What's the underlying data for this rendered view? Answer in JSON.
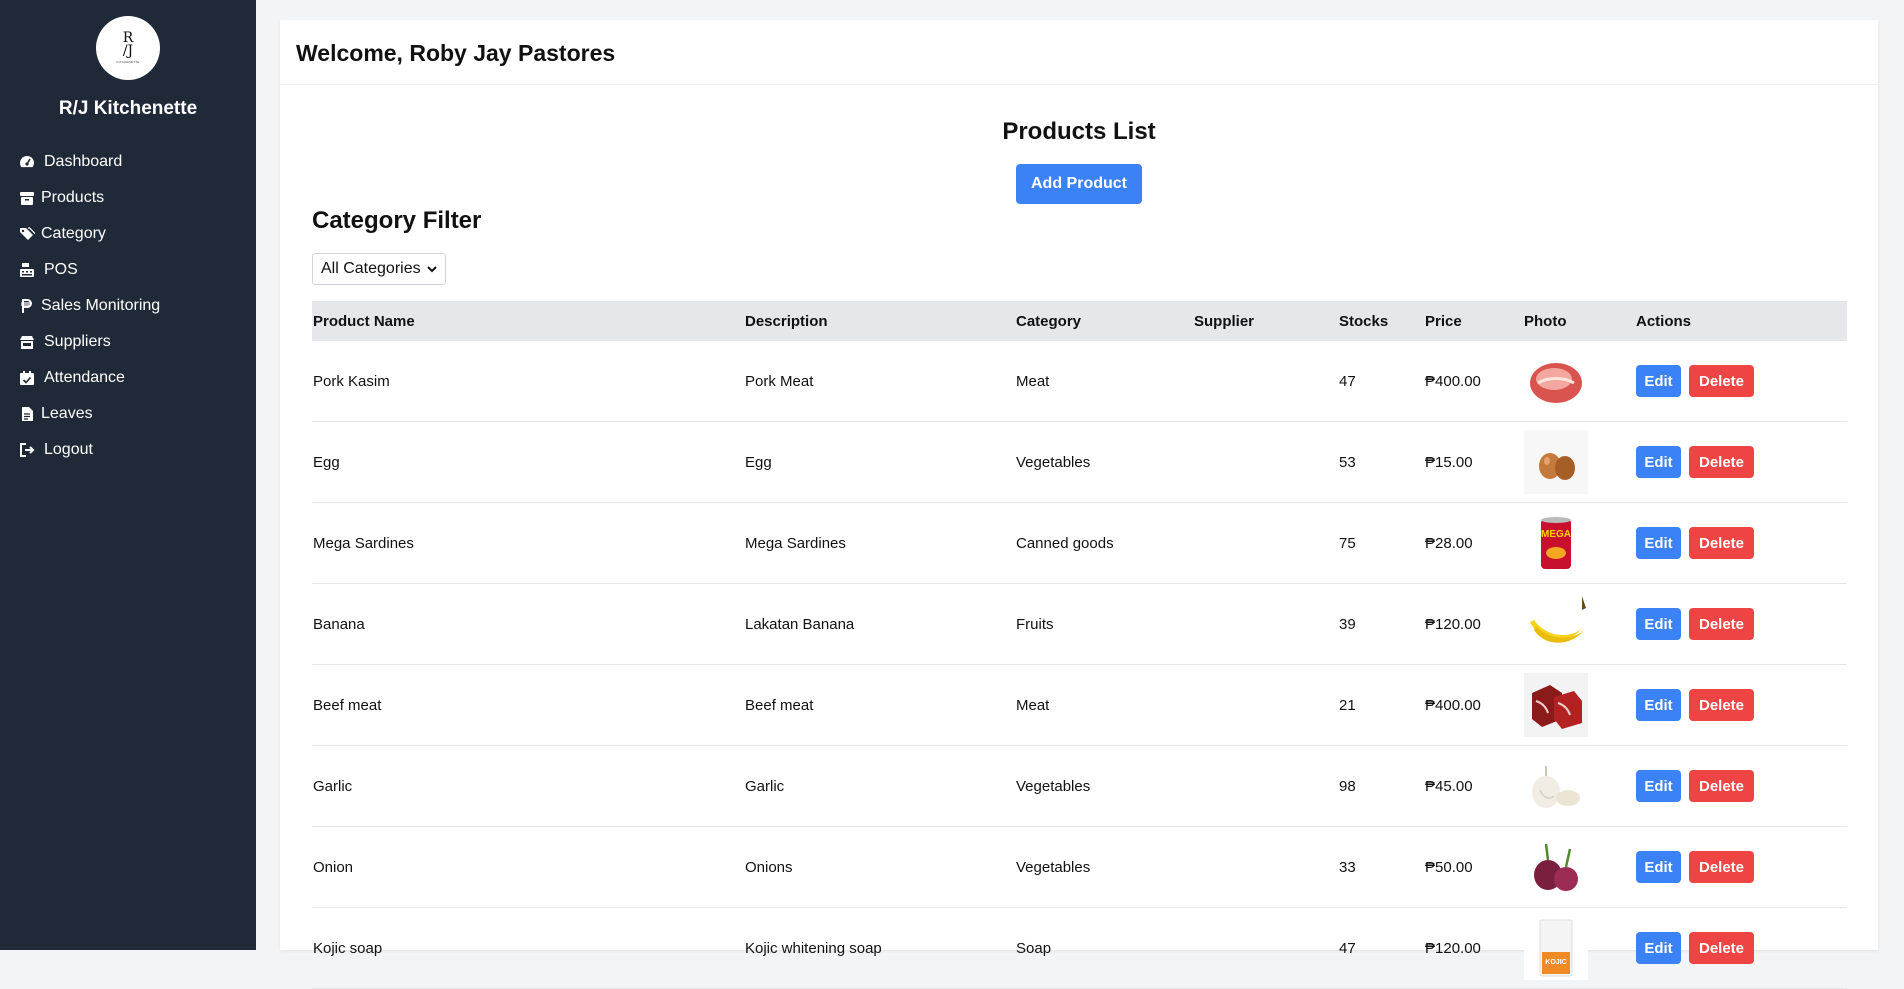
{
  "sidebar": {
    "logo_text": "R\nJ",
    "logo_subtext": "KITCHENETTE",
    "brand": "R/J Kitchenette",
    "items": [
      {
        "label": "Dashboard",
        "icon": "dashboard-gauge-icon"
      },
      {
        "label": "Products",
        "icon": "box-icon"
      },
      {
        "label": "Category",
        "icon": "tags-icon"
      },
      {
        "label": "POS",
        "icon": "cash-register-icon"
      },
      {
        "label": "Sales Monitoring",
        "icon": "peso-icon"
      },
      {
        "label": "Suppliers",
        "icon": "store-icon"
      },
      {
        "label": "Attendance",
        "icon": "calendar-check-icon"
      },
      {
        "label": "Leaves",
        "icon": "file-icon"
      },
      {
        "label": "Logout",
        "icon": "logout-icon"
      }
    ],
    "bg_color": "#1f2937"
  },
  "header": {
    "welcome": "Welcome, Roby Jay Pastores"
  },
  "main": {
    "title": "Products List",
    "add_button": "Add Product",
    "filter_title": "Category Filter",
    "filter_selected": "All Categories",
    "columns": [
      "Product Name",
      "Description",
      "Category",
      "Supplier",
      "Stocks",
      "Price",
      "Photo",
      "Actions"
    ],
    "edit_label": "Edit",
    "delete_label": "Delete",
    "rows": [
      {
        "name": "Pork Kasim",
        "description": "Pork Meat",
        "category": "Meat",
        "supplier": "",
        "stocks": "47",
        "price": "₱400.00",
        "photo": "pork"
      },
      {
        "name": "Egg",
        "description": "Egg",
        "category": "Vegetables",
        "supplier": "",
        "stocks": "53",
        "price": "₱15.00",
        "photo": "egg"
      },
      {
        "name": "Mega Sardines",
        "description": "Mega Sardines",
        "category": "Canned goods",
        "supplier": "",
        "stocks": "75",
        "price": "₱28.00",
        "photo": "sardines"
      },
      {
        "name": "Banana",
        "description": "Lakatan Banana",
        "category": "Fruits",
        "supplier": "",
        "stocks": "39",
        "price": "₱120.00",
        "photo": "banana"
      },
      {
        "name": "Beef meat",
        "description": "Beef meat",
        "category": "Meat",
        "supplier": "",
        "stocks": "21",
        "price": "₱400.00",
        "photo": "beef"
      },
      {
        "name": "Garlic",
        "description": "Garlic",
        "category": "Vegetables",
        "supplier": "",
        "stocks": "98",
        "price": "₱45.00",
        "photo": "garlic"
      },
      {
        "name": "Onion",
        "description": "Onions",
        "category": "Vegetables",
        "supplier": "",
        "stocks": "33",
        "price": "₱50.00",
        "photo": "onion"
      },
      {
        "name": "Kojic soap",
        "description": "Kojic whitening soap",
        "category": "Soap",
        "supplier": "",
        "stocks": "47",
        "price": "₱120.00",
        "photo": "soap"
      }
    ]
  },
  "colors": {
    "primary": "#3b82f6",
    "danger": "#ef4444",
    "table_header_bg": "#e5e7eb"
  }
}
